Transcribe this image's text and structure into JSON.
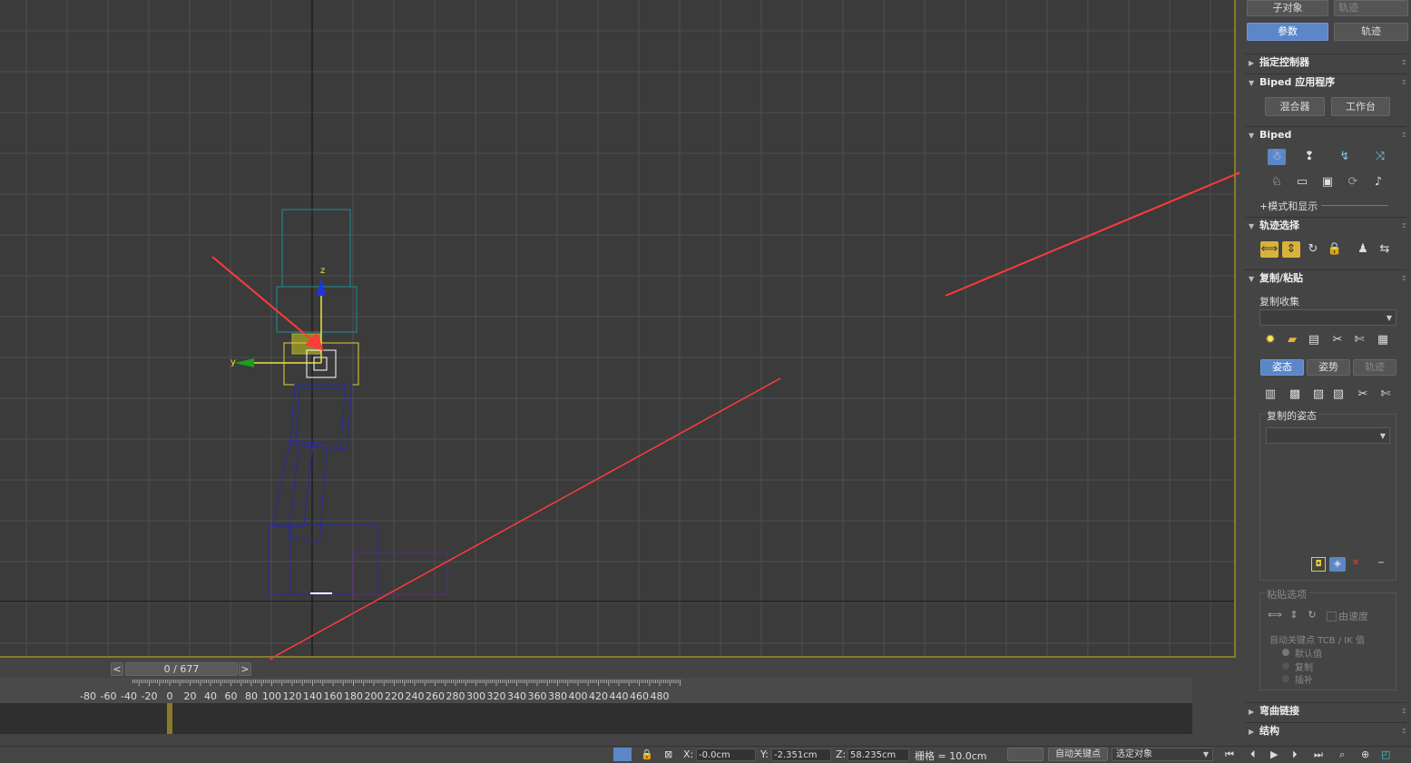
{
  "viewport": {
    "axis_z_label": "z",
    "axis_y_label": "y",
    "colors": {
      "bg": "#3b3b3b",
      "grid": "#4f4f4f",
      "border": "#8a7a2a",
      "arrow": "#ff3b3b"
    }
  },
  "panel": {
    "top_buttons": {
      "subobject": "子对象",
      "track_disabled": "轨迹",
      "params": "参数",
      "track": "轨迹"
    },
    "rollouts": {
      "assign_controller": "指定控制器",
      "biped_apps": "Biped 应用程序",
      "biped": "Biped",
      "track_select": "轨迹选择",
      "copy_paste": "复制/粘贴",
      "bend_links": "弯曲链接",
      "structure": "结构"
    },
    "biped_apps": {
      "mixer": "混合器",
      "workbench": "工作台"
    },
    "biped": {
      "mode_display": "+模式和显示",
      "icons_row1": [
        "figure-mode-icon",
        "footstep-mode-icon",
        "motion-flow-icon",
        "mixer-mode-icon"
      ],
      "icons_row2": [
        "biped-playback-icon",
        "load-file-icon",
        "save-file-icon",
        "convert-icon",
        "move-all-icon"
      ]
    },
    "track_select": {
      "icons": [
        "body-horizontal-icon",
        "body-vertical-icon",
        "body-rotation-icon",
        "lock-cog-icon",
        "symmetrical-icon",
        "opposite-icon"
      ]
    },
    "copy_paste": {
      "copy_collection": "复制收集",
      "tabs": {
        "posture": "姿态",
        "pose": "姿势",
        "track": "轨迹"
      },
      "copied_postures": "复制的姿态",
      "paste_options": "粘贴选项",
      "by_velocity": "由速度",
      "auto_key_tcb": "自动关键点 TCB / IK 值",
      "radio_default": "默认值",
      "radio_copy": "复制",
      "radio_interp": "插补"
    }
  },
  "timeline": {
    "frame_counter": "0 / 677",
    "prev": "<",
    "next": ">",
    "ticks": [
      "-80",
      "-60",
      "-40",
      "-20",
      "0",
      "20",
      "40",
      "60",
      "80",
      "100",
      "120",
      "140",
      "160",
      "180",
      "200",
      "220",
      "240",
      "260",
      "280",
      "300",
      "320",
      "340",
      "360",
      "380",
      "400",
      "420",
      "440",
      "460",
      "480"
    ]
  },
  "statusbar": {
    "x_label": "X:",
    "x_value": "-0.0cm",
    "y_label": "Y:",
    "y_value": "-2.351cm",
    "z_label": "Z:",
    "z_value": "58.235cm",
    "grid": "栅格 = 10.0cm",
    "auto_key": "自动关键点",
    "selected": "选定对象"
  }
}
